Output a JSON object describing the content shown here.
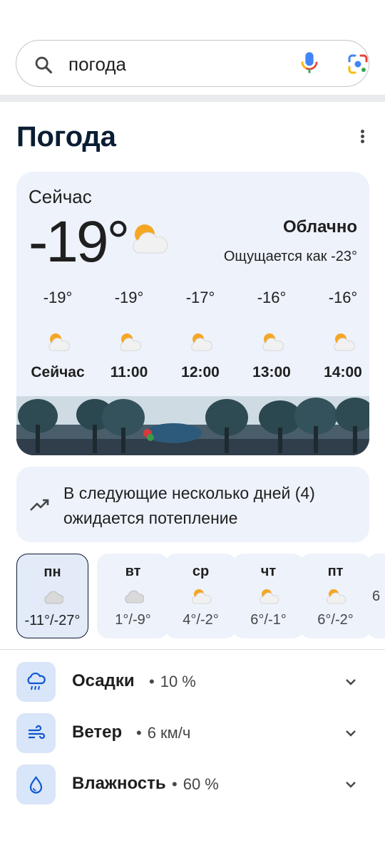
{
  "search": {
    "query": "погода"
  },
  "header": {
    "title": "Погода"
  },
  "current": {
    "label": "Сейчас",
    "temperature": "-19°",
    "condition": "Облачно",
    "feels_like": "Ощущается как -23°",
    "icon": "partly-cloudy-icon"
  },
  "hourly": [
    {
      "temp": "-19°",
      "time": "Сейчас",
      "icon": "partly-cloudy-icon"
    },
    {
      "temp": "-19°",
      "time": "11:00",
      "icon": "partly-cloudy-icon"
    },
    {
      "temp": "-17°",
      "time": "12:00",
      "icon": "partly-cloudy-icon"
    },
    {
      "temp": "-16°",
      "time": "13:00",
      "icon": "partly-cloudy-icon"
    },
    {
      "temp": "-16°",
      "time": "14:00",
      "icon": "partly-cloudy-icon"
    }
  ],
  "trend": {
    "text": "В следующие несколько дней (4) ожидается потепление",
    "icon": "trending-up-icon"
  },
  "daily": [
    {
      "day": "пн",
      "range": "-11°/-27°",
      "icon": "cloud-icon",
      "selected": true
    },
    {
      "day": "вт",
      "range": "1°/-9°",
      "icon": "cloud-icon"
    },
    {
      "day": "ср",
      "range": "4°/-2°",
      "icon": "partly-cloudy-icon"
    },
    {
      "day": "чт",
      "range": "6°/-1°",
      "icon": "partly-cloudy-icon"
    },
    {
      "day": "пт",
      "range": "6°/-2°",
      "icon": "partly-cloudy-icon"
    },
    {
      "day": "",
      "range": "6",
      "icon": ""
    }
  ],
  "details": [
    {
      "label": "Осадки",
      "value": "10 %",
      "icon": "rain-icon"
    },
    {
      "label": "Ветер",
      "value": "6 км/ч",
      "icon": "wind-icon"
    },
    {
      "label": "Влажность",
      "value": "60 %",
      "icon": "humidity-icon"
    }
  ],
  "colors": {
    "accent": "#0b57d0",
    "card": "#edf2fb",
    "title": "#0b1d33"
  }
}
